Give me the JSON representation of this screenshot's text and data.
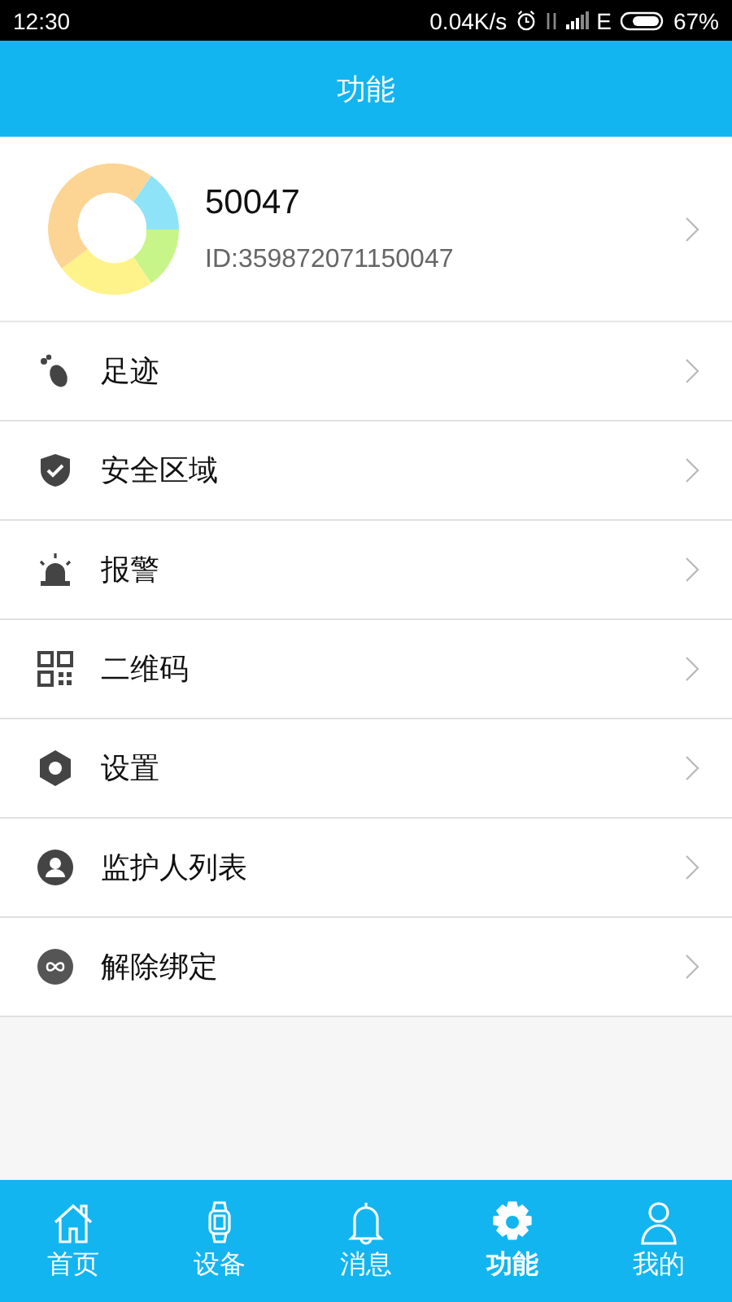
{
  "status_bar": {
    "time": "12:30",
    "speed": "0.04K/s",
    "network": "E",
    "battery": "67%"
  },
  "header": {
    "title": "功能"
  },
  "device": {
    "name": "50047",
    "id": "ID:359872071150047"
  },
  "menu": [
    {
      "kind": "footprint",
      "label": "足迹"
    },
    {
      "kind": "shield",
      "label": "安全区域"
    },
    {
      "kind": "alarm",
      "label": "报警"
    },
    {
      "kind": "qrcode",
      "label": "二维码"
    },
    {
      "kind": "settings",
      "label": "设置"
    },
    {
      "kind": "person",
      "label": "监护人列表"
    },
    {
      "kind": "unlink",
      "label": "解除绑定"
    }
  ],
  "tab_bar": [
    {
      "kind": "home",
      "label": "首页",
      "selected": false
    },
    {
      "kind": "watch",
      "label": "设备",
      "selected": false
    },
    {
      "kind": "bell",
      "label": "消息",
      "selected": false
    },
    {
      "kind": "gear",
      "label": "功能",
      "selected": true
    },
    {
      "kind": "user",
      "label": "我的",
      "selected": false
    }
  ]
}
